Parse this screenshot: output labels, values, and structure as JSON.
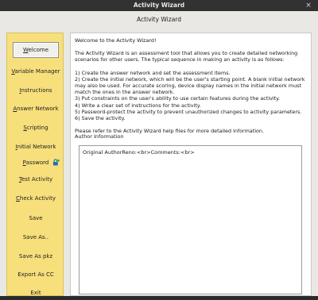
{
  "window": {
    "title": "Activity Wizard",
    "header_title": "Activity Wizard",
    "close_glyph": "×"
  },
  "sidebar": {
    "items": [
      {
        "label_u": "W",
        "label_rest": "elcome",
        "active": true
      },
      {
        "label_u": "V",
        "label_rest": "ariable Manager"
      },
      {
        "label_u": "I",
        "label_rest": "nstructions"
      },
      {
        "label_u": "A",
        "label_rest": "nswer Network"
      },
      {
        "label_u": "S",
        "label_rest": "cripting"
      },
      {
        "label_u": "I",
        "label_rest": "nitial Network"
      },
      {
        "label_u": "P",
        "label_rest": "assword",
        "icon": "lock-icon"
      },
      {
        "label_u": "T",
        "label_rest": "est Activity"
      },
      {
        "label_u": "C",
        "label_rest": "heck Activity"
      },
      {
        "label_u": "",
        "label_rest": "Save"
      },
      {
        "label_u": "",
        "label_rest": "Save As.."
      },
      {
        "label_u": "",
        "label_rest": "Save As pkz"
      },
      {
        "label_u": "",
        "label_rest": "Export As CC"
      },
      {
        "label_u": "",
        "label_rest": "Exit"
      }
    ]
  },
  "main": {
    "welcome_heading": "Welcome to the Activity Wizard!",
    "description": "The Activity Wizard is an assessment tool that allows you to create detailed networking scenarios for other users. The typical sequence in making an activity is as follows:",
    "steps": [
      "1) Create the answer network and set the assessment items.",
      "2) Create the initial network, which will be the user's starting point. A blank initial network may also be used. For accurate scoring, device display names in the initial network must match the ones in the answer network.",
      "3) Put constraints on the user's ability to use certain features during the activity.",
      "4) Write a clear set of instructions for the activity.",
      "5) Password-protect the activity to prevent unauthorized changes to activity parameters.",
      "6) Save the activity."
    ],
    "help_note": "Please refer to the Activity Wizard help files for more detailed information.",
    "author_label": "Author Information",
    "author_text": "Original AuthorReno:<br>Comments:<br>"
  },
  "colors": {
    "sidebar_bg": "#f7df7b",
    "titlebar_bg": "#323232",
    "window_bg": "#e9e8e4"
  }
}
